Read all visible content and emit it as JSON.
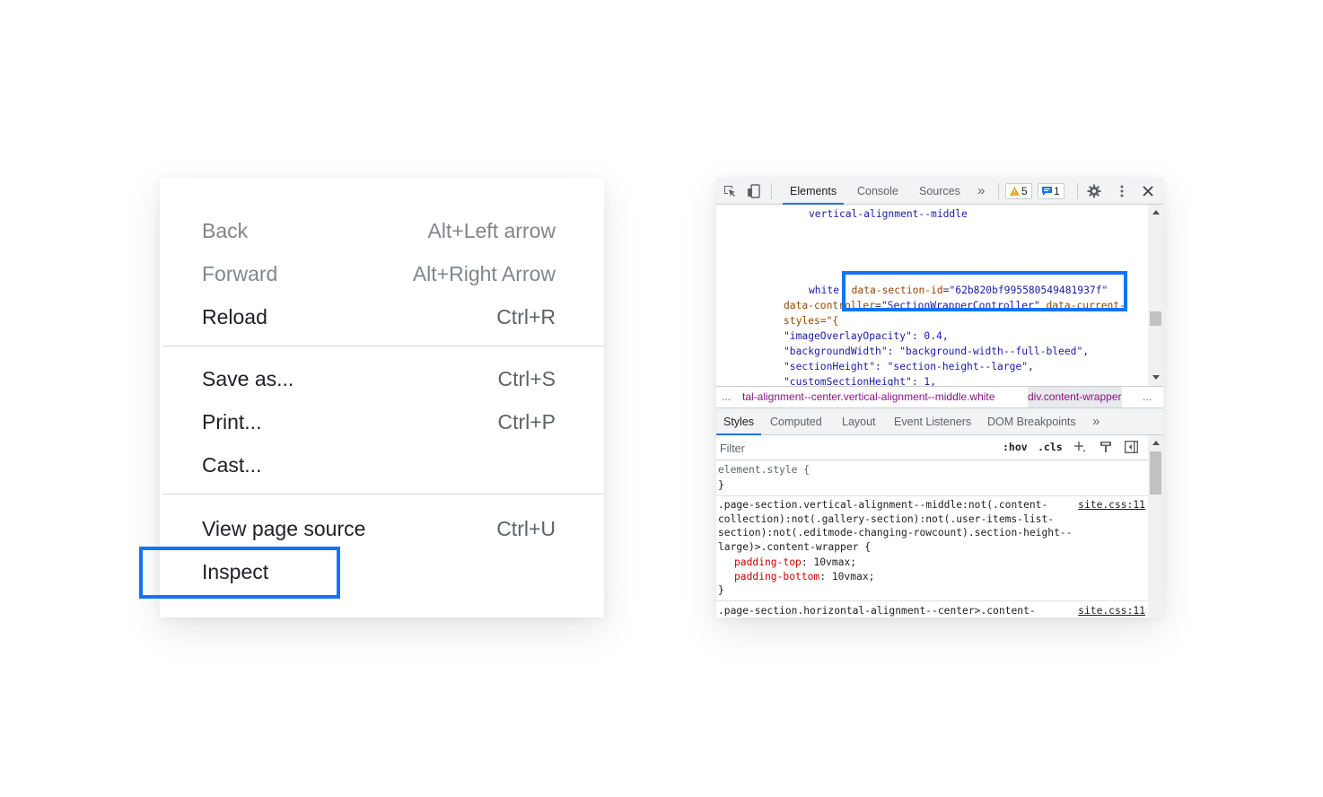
{
  "context_menu": {
    "items": [
      {
        "label": "Back",
        "shortcut": "Alt+Left arrow"
      },
      {
        "label": "Forward",
        "shortcut": "Alt+Right Arrow"
      },
      {
        "label": "Reload",
        "shortcut": "Ctrl+R"
      },
      {
        "label": "Save as...",
        "shortcut": "Ctrl+S"
      },
      {
        "label": "Print...",
        "shortcut": "Ctrl+P"
      },
      {
        "label": "Cast...",
        "shortcut": ""
      },
      {
        "label": "View page source",
        "shortcut": "Ctrl+U"
      },
      {
        "label": "Inspect",
        "shortcut": ""
      }
    ],
    "highlighted_item": "Inspect"
  },
  "devtools": {
    "tabs": [
      "Elements",
      "Console",
      "Sources"
    ],
    "active_tab": "Elements",
    "more_tabs": "»",
    "warnings_count": "5",
    "messages_count": "1",
    "elements_panel": {
      "lines": {
        "line1": "vertical-alignment--middle",
        "white": "white",
        "attr1_name": "data-section-id",
        "attr1_value": "\"62b820bf995580549481937f\"",
        "ctrl_name": "data-controller",
        "ctrl_value": "\"SectionWrapperController\"",
        "curr_name": "data-current-",
        "styles_open": "styles=\"{",
        "p1": "\"imageOverlayOpacity\": 0.4,",
        "p2": "\"backgroundWidth\": \"background-width--full-bleed\",",
        "p3": "\"sectionHeight\": \"section-height--large\",",
        "p4": "\"customSectionHeight\": 1,"
      },
      "highlighted_attribute": "data-section-id=\"62b820bf995580549481937f\""
    },
    "breadcrumbs": {
      "prefix": "...",
      "crumb1": "tal-alignment--center.vertical-alignment--middle.white",
      "crumb2": "div.content-wrapper",
      "suffix": "..."
    },
    "styles_tabs": [
      "Styles",
      "Computed",
      "Layout",
      "Event Listeners",
      "DOM Breakpoints"
    ],
    "styles_more": "»",
    "filter": {
      "placeholder": "Filter",
      "hov": ":hov",
      "cls": ".cls"
    },
    "rules": {
      "element_style_open": "element.style {",
      "close": "}",
      "rule1_sel1": ".page-section.vertical-alignment--middle:not(.content-",
      "rule1_sel2": "collection):not(.gallery-section):not(.user-items-list-",
      "rule1_sel3": "section):not(.editmode-changing-rowcount).section-height--",
      "rule1_sel4": "large)>.content-wrapper {",
      "rule1_link": "site.css:11",
      "rule1_prop1": "padding-top",
      "rule1_val1": "10vmax;",
      "rule1_prop2": "padding-bottom",
      "rule1_val2": "10vmax;",
      "rule2_sel1": ".page-section.horizontal-alignment--center>.content-",
      "rule2_link": "site.css:11"
    }
  },
  "colors": {
    "highlight_box": "#1273ff",
    "active_tab_underline": "#1a73e8",
    "warning": "#f2a600",
    "info": "#1a73e8"
  }
}
